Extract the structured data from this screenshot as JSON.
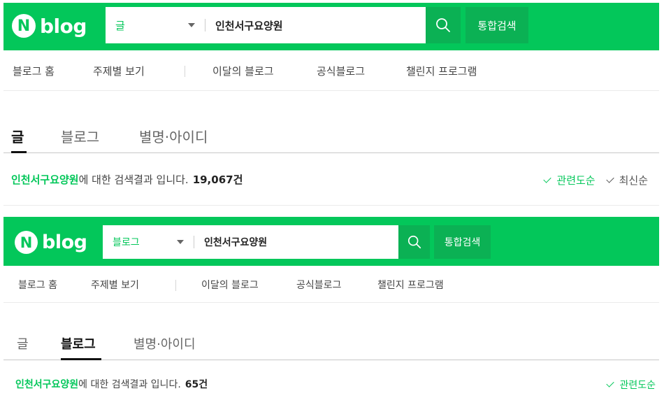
{
  "colors": {
    "brand": "#03c75a",
    "brand_dark": "#0bb154"
  },
  "panels": [
    {
      "logo": {
        "mark": "N",
        "text": "blog"
      },
      "search": {
        "scope": "글",
        "query": "인천서구요양원",
        "total_search_label": "통합검색"
      },
      "nav": [
        "블로그 홈",
        "주제별 보기",
        "이달의 블로그",
        "공식블로그",
        "챌린지 프로그램"
      ],
      "tabs": [
        "글",
        "블로그",
        "별명·아이디"
      ],
      "active_tab": "글",
      "result": {
        "query": "인천서구요양원",
        "suffix": "에 대한 검색결과 입니다.",
        "count": "19,067건"
      },
      "sort": [
        "관련도순",
        "최신순"
      ]
    },
    {
      "logo": {
        "mark": "N",
        "text": "blog"
      },
      "search": {
        "scope": "블로그",
        "query": "인천서구요양원",
        "total_search_label": "통합검색"
      },
      "nav": [
        "블로그 홈",
        "주제별 보기",
        "이달의 블로그",
        "공식블로그",
        "챌린지 프로그램"
      ],
      "tabs": [
        "글",
        "블로그",
        "별명·아이디"
      ],
      "active_tab": "블로그",
      "result": {
        "query": "인천서구요양원",
        "suffix": "에 대한 검색결과 입니다.",
        "count": "65건"
      },
      "sort": [
        "관련도순"
      ]
    }
  ],
  "icons": {
    "search": "search-icon",
    "dropdown": "chevron-down-icon",
    "sort_selected": "checkmark-icon"
  }
}
